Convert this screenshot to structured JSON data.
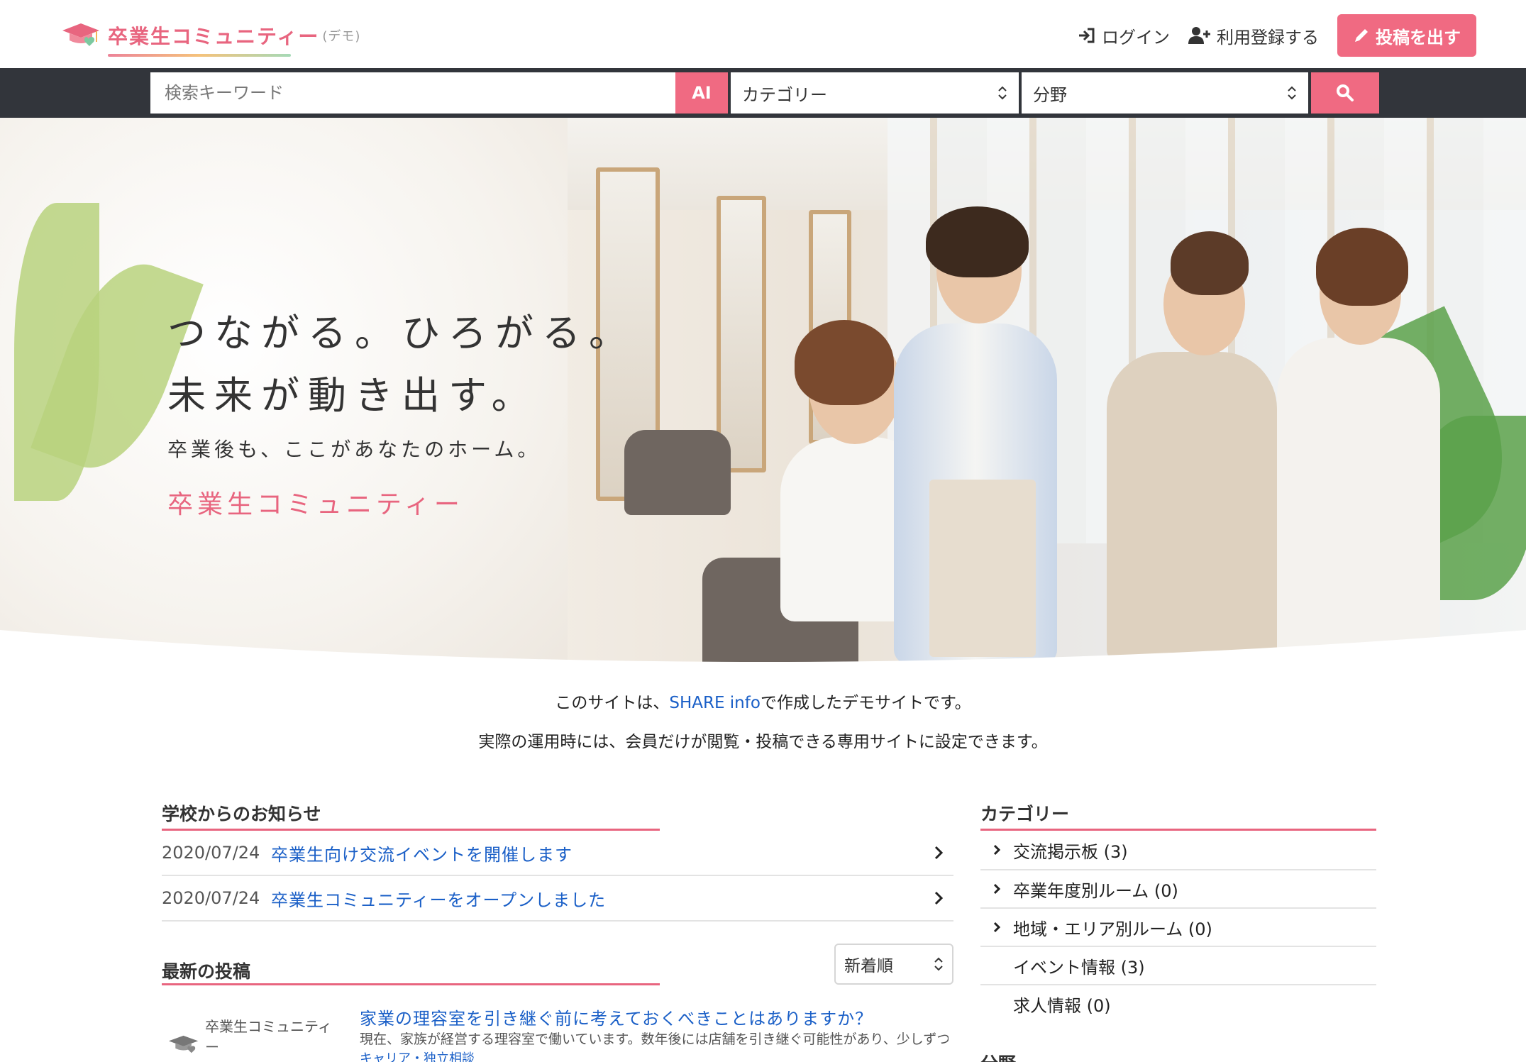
{
  "header": {
    "logo_text": "卒業生コミュニティー",
    "logo_demo": "(デモ)",
    "login_label": "ログイン",
    "register_label": "利用登録する",
    "post_button_label": "投稿を出す"
  },
  "search": {
    "keyword_placeholder": "検索キーワード",
    "ai_label": "AI",
    "category_label": "カテゴリー",
    "field_label": "分野"
  },
  "hero": {
    "line1": "つながる。ひろがる。",
    "line2": "未来が動き出す。",
    "line3": "卒業後も、ここがあなたのホーム。",
    "line4": "卒業生コミュニティー"
  },
  "notice": {
    "line1_prefix": "このサイトは、",
    "line1_link": "SHARE info",
    "line1_suffix": "で作成したデモサイトです。",
    "line2": "実際の運用時には、会員だけが閲覧・投稿できる専用サイトに設定できます。"
  },
  "school_news": {
    "title": "学校からのお知らせ",
    "items": [
      {
        "date": "2020/07/24",
        "title": "卒業生向け交流イベントを開催します"
      },
      {
        "date": "2020/07/24",
        "title": "卒業生コミュニティーをオープンしました"
      }
    ]
  },
  "latest_posts": {
    "title": "最新の投稿",
    "sort_label": "新着順",
    "items": [
      {
        "thumb_text": "卒業生コミュニティー",
        "title": "家業の理容室を引き継ぐ前に考えておくべきことはありますか？",
        "excerpt": "現在、家族が経営する理容室で働いています。数年後には店舗を引き継ぐ可能性があり、少しずつ...",
        "category": "キャリア・独立相談"
      }
    ]
  },
  "categories": {
    "title": "カテゴリー",
    "items": [
      {
        "label": "交流掲示板 (3)",
        "expandable": true
      },
      {
        "label": "卒業年度別ルーム (0)",
        "expandable": true
      },
      {
        "label": "地域・エリア別ルーム (0)",
        "expandable": true
      },
      {
        "label": "イベント情報 (3)",
        "expandable": false
      },
      {
        "label": "求人情報 (0)",
        "expandable": false
      }
    ],
    "next_section_title": "分野"
  },
  "colors": {
    "accent": "#f06a82",
    "search_bar_bg": "#32353b",
    "link": "#1a5fc7"
  },
  "icons": {
    "login": "sign-in-icon",
    "register": "user-plus-icon",
    "post": "pencil-icon",
    "search": "search-icon",
    "select": "up-down-chevron-icon",
    "row": "chevron-right-icon"
  }
}
